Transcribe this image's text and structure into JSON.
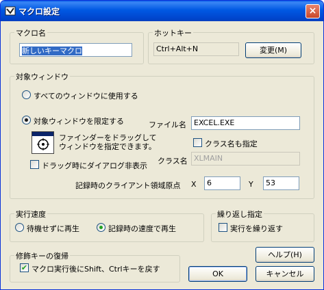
{
  "window": {
    "title": "マクロ設定",
    "close_glyph": "×"
  },
  "macro_name": {
    "legend": "マクロ名",
    "value": "新しいキーマクロ"
  },
  "hotkey": {
    "legend": "ホットキー",
    "value": "Ctrl+Alt+N",
    "change_button": "変更(M)"
  },
  "target_window": {
    "legend": "対象ウィンドウ",
    "radio_all": "すべてのウィンドウに使用する",
    "radio_limit": "対象ウィンドウを限定する",
    "finder_text_line1": "ファインダーをドラッグして",
    "finder_text_line2": "ウィンドウを指定できます。",
    "no_dialog_check": "ドラッグ時にダイアログ非表示",
    "filename_label": "ファイル名",
    "filename_value": "EXCEL.EXE",
    "class_check": "クラス名も指定",
    "classname_label": "クラス名",
    "classname_value": "XLMAIN",
    "origin_label": "記録時のクライアント領域原点",
    "x_label": "X",
    "x_value": "6",
    "y_label": "Y",
    "y_value": "53"
  },
  "speed": {
    "legend": "実行速度",
    "radio_nowait": "待機せずに再生",
    "radio_recorded": "記録時の速度で再生"
  },
  "repeat": {
    "legend": "繰り返し指定",
    "check_label": "実行を繰り返す"
  },
  "modifier": {
    "legend": "修飾キーの復帰",
    "check_label": "マクロ実行後にShift、Ctrlキーを戻す"
  },
  "buttons": {
    "help": "ヘルプ(H)",
    "ok": "OK",
    "cancel": "キャンセル"
  },
  "colors": {
    "titlebar": "#0058e6",
    "dialog_bg": "#ece9d8",
    "selection": "#316ac5"
  }
}
